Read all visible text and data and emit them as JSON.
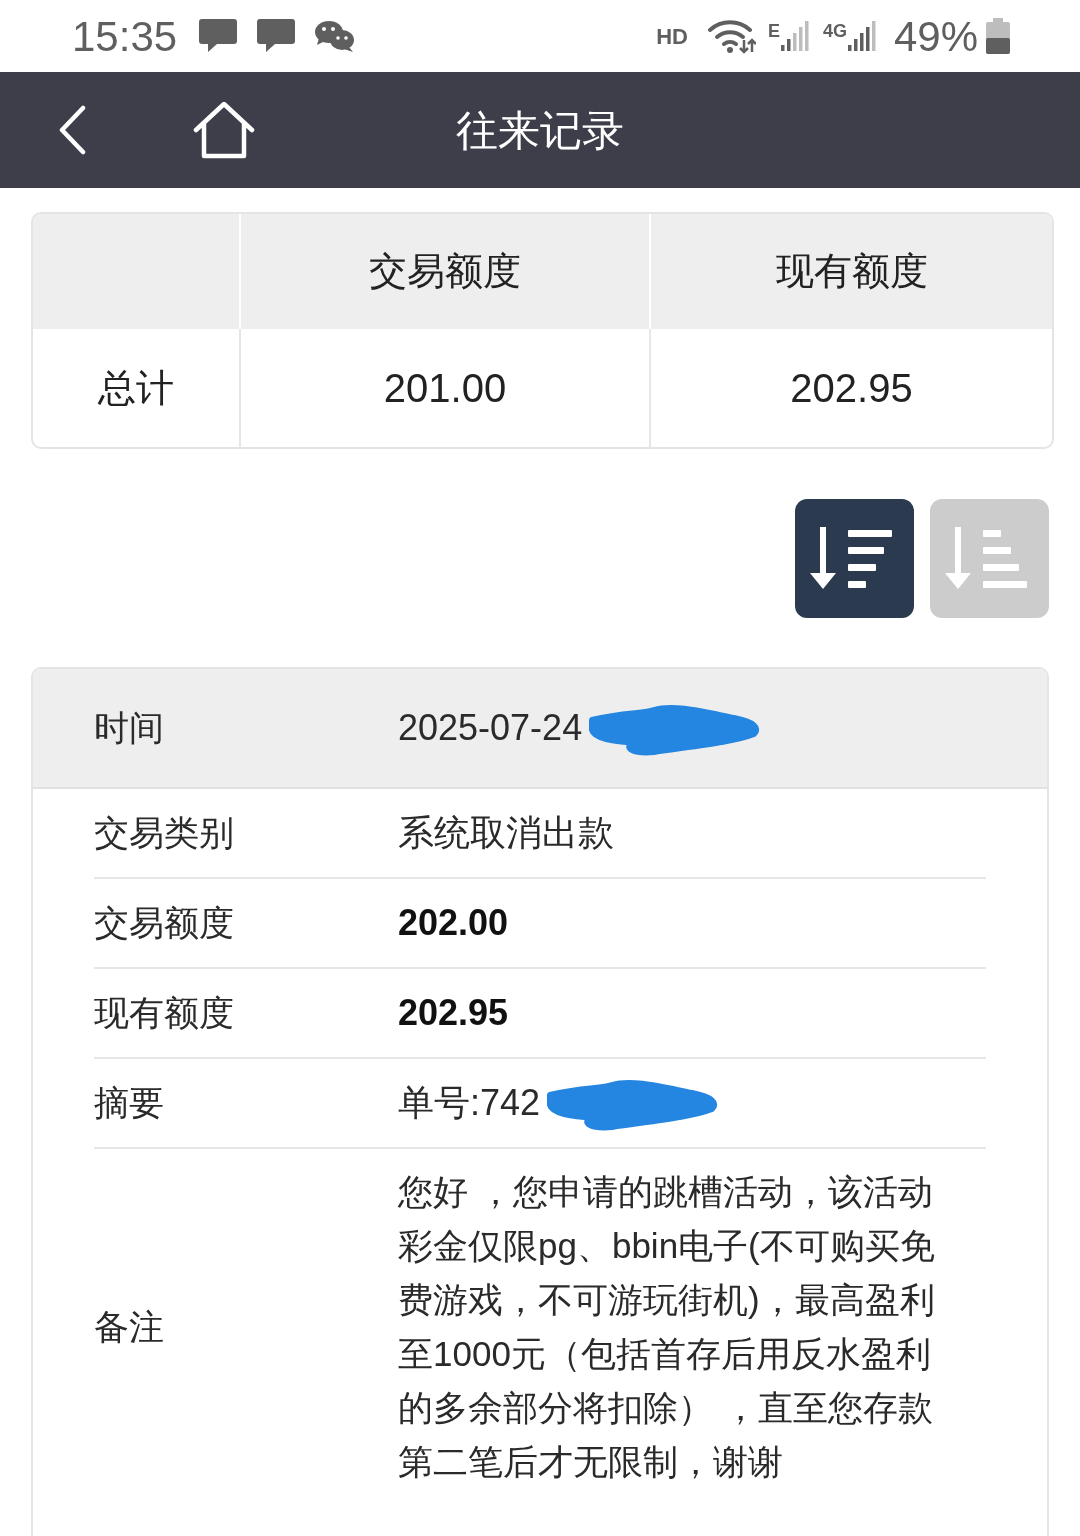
{
  "status_bar": {
    "time": "15:35",
    "hd": "HD",
    "networks": [
      "E",
      "4G"
    ],
    "battery": "49%"
  },
  "header": {
    "title": "往来记录"
  },
  "totals": {
    "columns": [
      "交易额度",
      "现有额度"
    ],
    "row": {
      "label": "总计",
      "values": [
        "201.00",
        "202.95"
      ]
    }
  },
  "sort_buttons": [
    {
      "kind": "descending",
      "selected": true
    },
    {
      "kind": "ascending",
      "selected": false
    }
  ],
  "record": {
    "rows": [
      {
        "kind": "heading",
        "label": "时间",
        "value": "2025-07-24",
        "redacted": true
      },
      {
        "kind": "text",
        "label": "交易类别",
        "value": "系统取消出款",
        "redacted": false
      },
      {
        "kind": "amount",
        "label": "交易额度",
        "value": "202.00",
        "redacted": false
      },
      {
        "kind": "amount",
        "label": "现有额度",
        "value": "202.95",
        "redacted": false
      },
      {
        "kind": "text",
        "label": "摘要",
        "value": "单号:742",
        "redacted": true
      },
      {
        "kind": "note",
        "label": "备注",
        "lines": [
          "您好 ，您申请的跳槽活动，该活动",
          "彩金仅限pg、bbin电子(不可购买免",
          "费游戏，不可游玩街机)，最高盈利",
          "至1000元（包括首存后用反水盈利",
          "的多余部分将扣除） ，直至您存款",
          "第二笔后才无限制，谢谢"
        ],
        "redacted": false
      }
    ]
  }
}
